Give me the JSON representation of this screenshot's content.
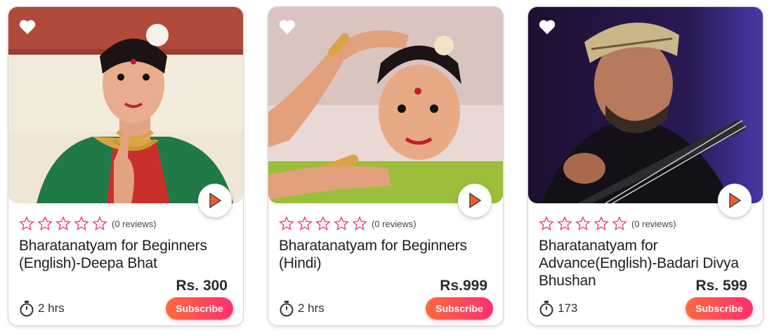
{
  "courses": [
    {
      "reviews": "(0 reviews)",
      "title": "Bharatanatyam for Beginners (English)-Deepa Bhat",
      "price": "Rs. 300",
      "duration": "2 hrs",
      "subscribe_label": "Subscribe",
      "thumbnail": "dancer in green saree with jewellery",
      "icons": [
        "heart-icon",
        "play-icon",
        "star-icon",
        "stopwatch-icon"
      ]
    },
    {
      "reviews": "(0 reviews)",
      "title": "Bharatanatyam for Beginners (Hindi)",
      "price": "Rs.999",
      "duration": "2 hrs",
      "subscribe_label": "Subscribe",
      "thumbnail": "dancer posing with raised arms",
      "icons": [
        "heart-icon",
        "play-icon",
        "star-icon",
        "stopwatch-icon"
      ]
    },
    {
      "reviews": "(0 reviews)",
      "title": "Bharatanatyam for Advance(English)-Badari Divya Bhushan",
      "price": "Rs. 599",
      "duration": "173",
      "subscribe_label": "Subscribe",
      "thumbnail": "man in bandana playing guitar",
      "icons": [
        "heart-icon",
        "play-icon",
        "star-icon",
        "stopwatch-icon"
      ]
    }
  ],
  "rating_stars": 5,
  "colors": {
    "star_outline": "#e8326e",
    "subscribe_start": "#ff6a3d",
    "subscribe_end": "#ff2f71",
    "play_arrow": "#f05a28"
  }
}
